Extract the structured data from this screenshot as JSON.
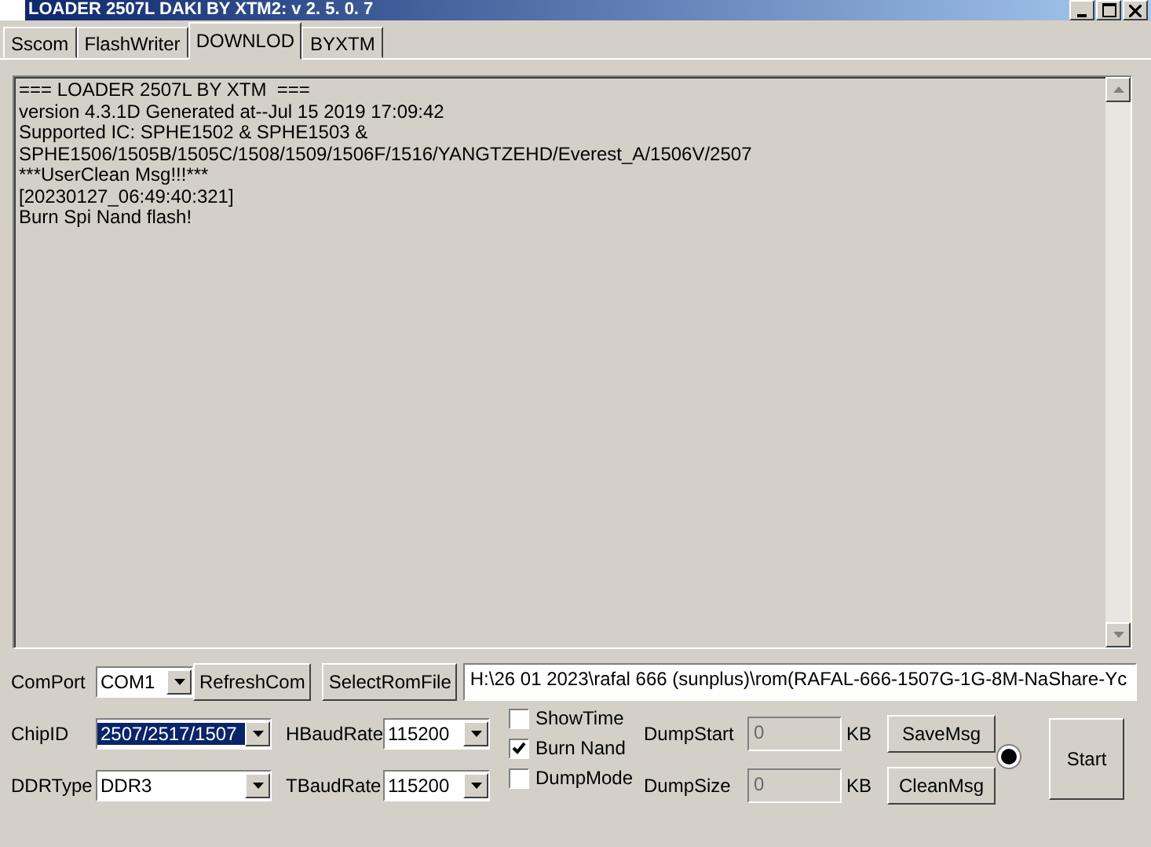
{
  "window": {
    "title": "LOADER 2507L DAKI BY XTM2: v  2. 5. 0. 7"
  },
  "tabs": [
    {
      "label": "Sscom",
      "selected": false
    },
    {
      "label": "FlashWriter",
      "selected": false
    },
    {
      "label": "DOWNLOD",
      "selected": true
    },
    {
      "label": "BYXTM",
      "selected": false
    }
  ],
  "log": {
    "lines": [
      "=== LOADER 2507L BY XTM  ===",
      "version 4.3.1D Generated at--Jul 15 2019 17:09:42",
      "Supported IC: SPHE1502 & SPHE1503 &",
      "SPHE1506/1505B/1505C/1508/1509/1506F/1516/YANGTZEHD/Everest_A/1506V/2507",
      "***UserClean Msg!!!***",
      "[20230127_06:49:40:321]",
      "Burn Spi Nand flash!"
    ]
  },
  "comport": {
    "label": "ComPort",
    "value": "COM1"
  },
  "refresh_button": "RefreshCom",
  "select_rom_button": "SelectRomFile",
  "rom_path": "H:\\26 01 2023\\rafal 666 (sunplus)\\rom(RAFAL-666-1507G-1G-8M-NaShare-Yc",
  "chip_id": {
    "label": "ChipID",
    "value": "2507/2517/1507",
    "selected": true
  },
  "ddr_type": {
    "label": "DDRType",
    "value": "DDR3"
  },
  "hbaud": {
    "label": "HBaudRate",
    "value": "115200"
  },
  "tbaud": {
    "label": "TBaudRate",
    "value": "115200"
  },
  "checkboxes": [
    {
      "label": "ShowTime",
      "checked": false
    },
    {
      "label": "Burn Nand",
      "checked": true
    },
    {
      "label": "DumpMode",
      "checked": false
    }
  ],
  "dump_start": {
    "label": "DumpStart",
    "value": "0",
    "unit": "KB",
    "disabled": true
  },
  "dump_size": {
    "label": "DumpSize",
    "value": "0",
    "unit": "KB",
    "disabled": true
  },
  "save_button": "SaveMsg",
  "clean_button": "CleanMsg",
  "indicator": {
    "selected": true
  },
  "start_button": "Start"
}
